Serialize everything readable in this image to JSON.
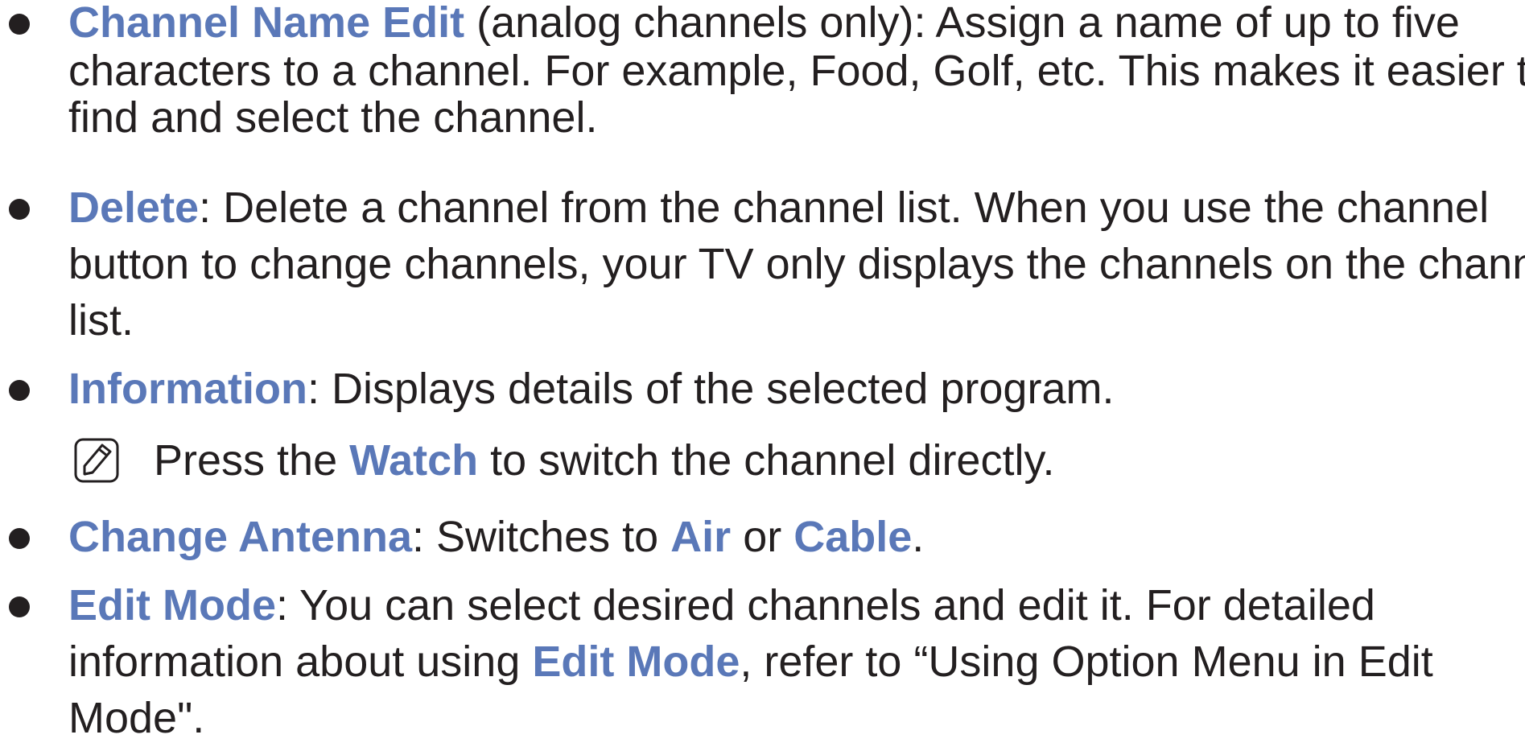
{
  "items": [
    {
      "term": "Channel Name Edit",
      "lines": [
        " (analog channels only): Assign a name of up to five",
        "characters to a channel. For example, Food, Golf, etc. This makes it easier to",
        "find and select the channel."
      ]
    },
    {
      "term": "Delete",
      "lines": [
        ": Delete a channel from the channel list. When you use the channel",
        "button to change channels, your TV only displays the channels on the channel",
        "list."
      ]
    },
    {
      "term": "Information",
      "lines": [
        ": Displays details of the selected program."
      ],
      "note": {
        "icon": "note-pencil-icon",
        "prefix": "Press the ",
        "term": "Watch",
        "suffix": " to switch the channel directly."
      }
    },
    {
      "term": "Change Antenna",
      "lines": [
        ": Switches to "
      ],
      "term2": "Air",
      "mid": " or ",
      "term3": "Cable",
      "end": "."
    },
    {
      "term": "Edit Mode",
      "lines": [
        ": You can select desired channels and edit it. For detailed",
        "information about using ",
        "Mode\"."
      ],
      "inline_term": "Edit Mode",
      "line2_suffix": ", refer to “Using Option Menu in Edit"
    }
  ],
  "colors": {
    "keyword": "#5a78b8",
    "text": "#231f20"
  }
}
